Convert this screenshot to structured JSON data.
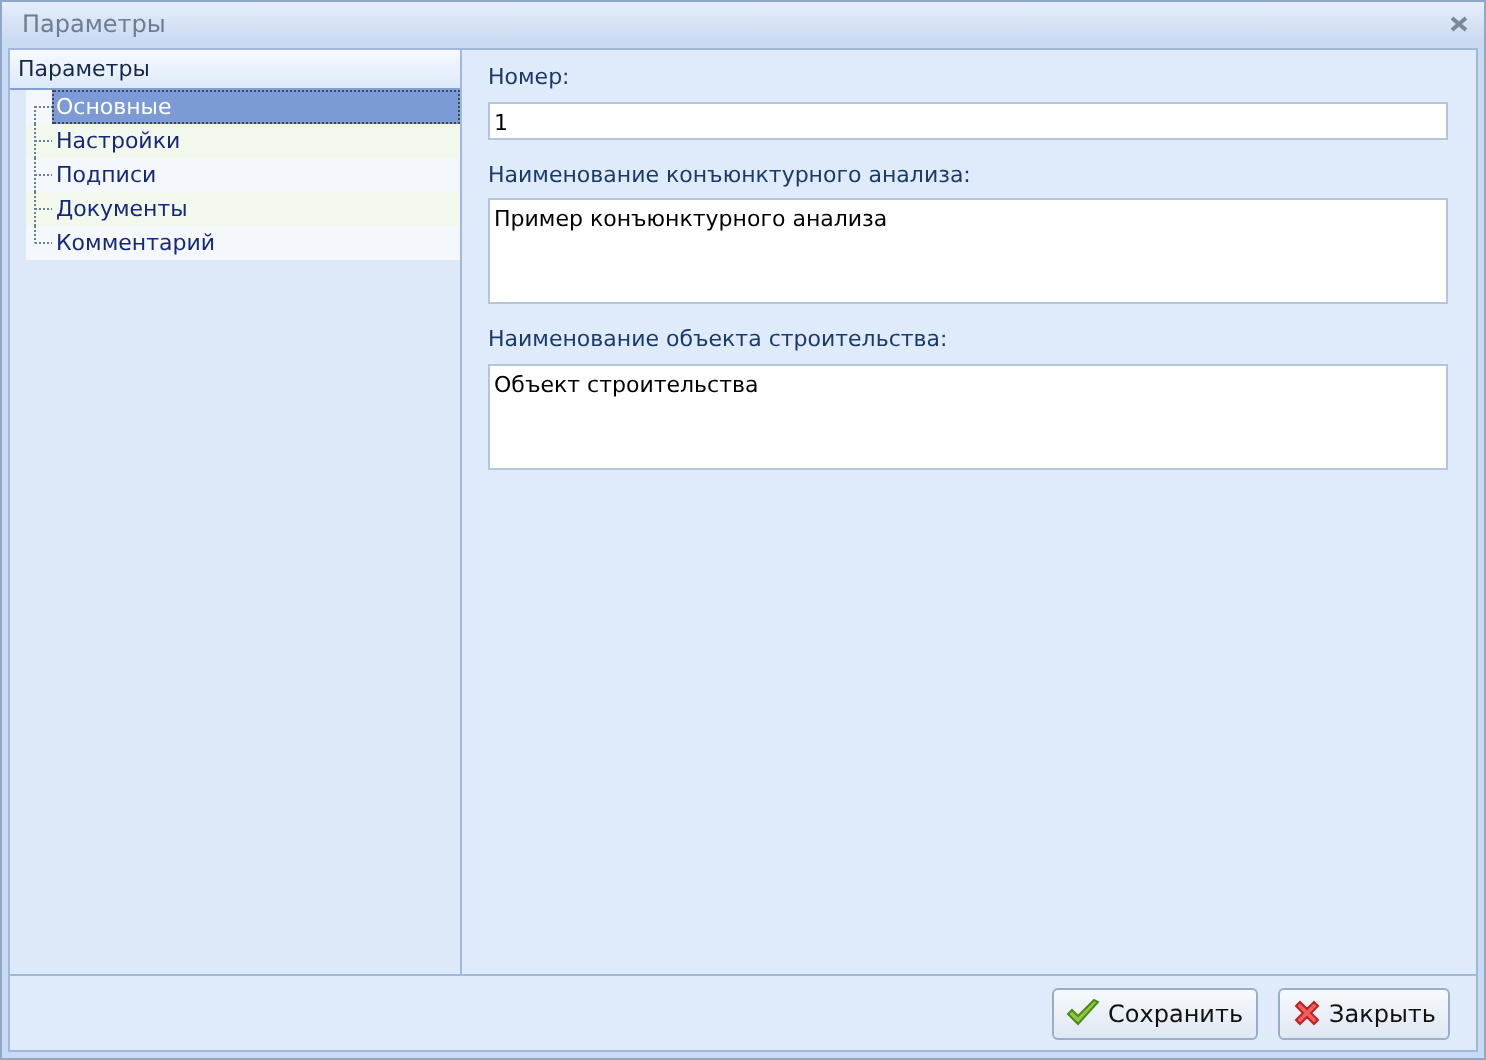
{
  "window": {
    "title": "Параметры"
  },
  "sidebar": {
    "header": "Параметры",
    "items": [
      {
        "label": "Основные",
        "selected": true
      },
      {
        "label": "Настройки",
        "selected": false
      },
      {
        "label": "Подписи",
        "selected": false
      },
      {
        "label": "Документы",
        "selected": false
      },
      {
        "label": "Комментарий",
        "selected": false
      }
    ]
  },
  "form": {
    "fields": [
      {
        "label": "Номер:",
        "value": "1",
        "kind": "line"
      },
      {
        "label": "Наименование конъюнктурного анализа:",
        "value": "Пример конъюнктурного анализа",
        "kind": "area"
      },
      {
        "label": "Наименование объекта строительства:",
        "value": "Объект строительства",
        "kind": "area"
      }
    ]
  },
  "buttons": [
    {
      "label": "Сохранить",
      "kind": "save"
    },
    {
      "label": "Закрыть",
      "kind": "close"
    }
  ]
}
